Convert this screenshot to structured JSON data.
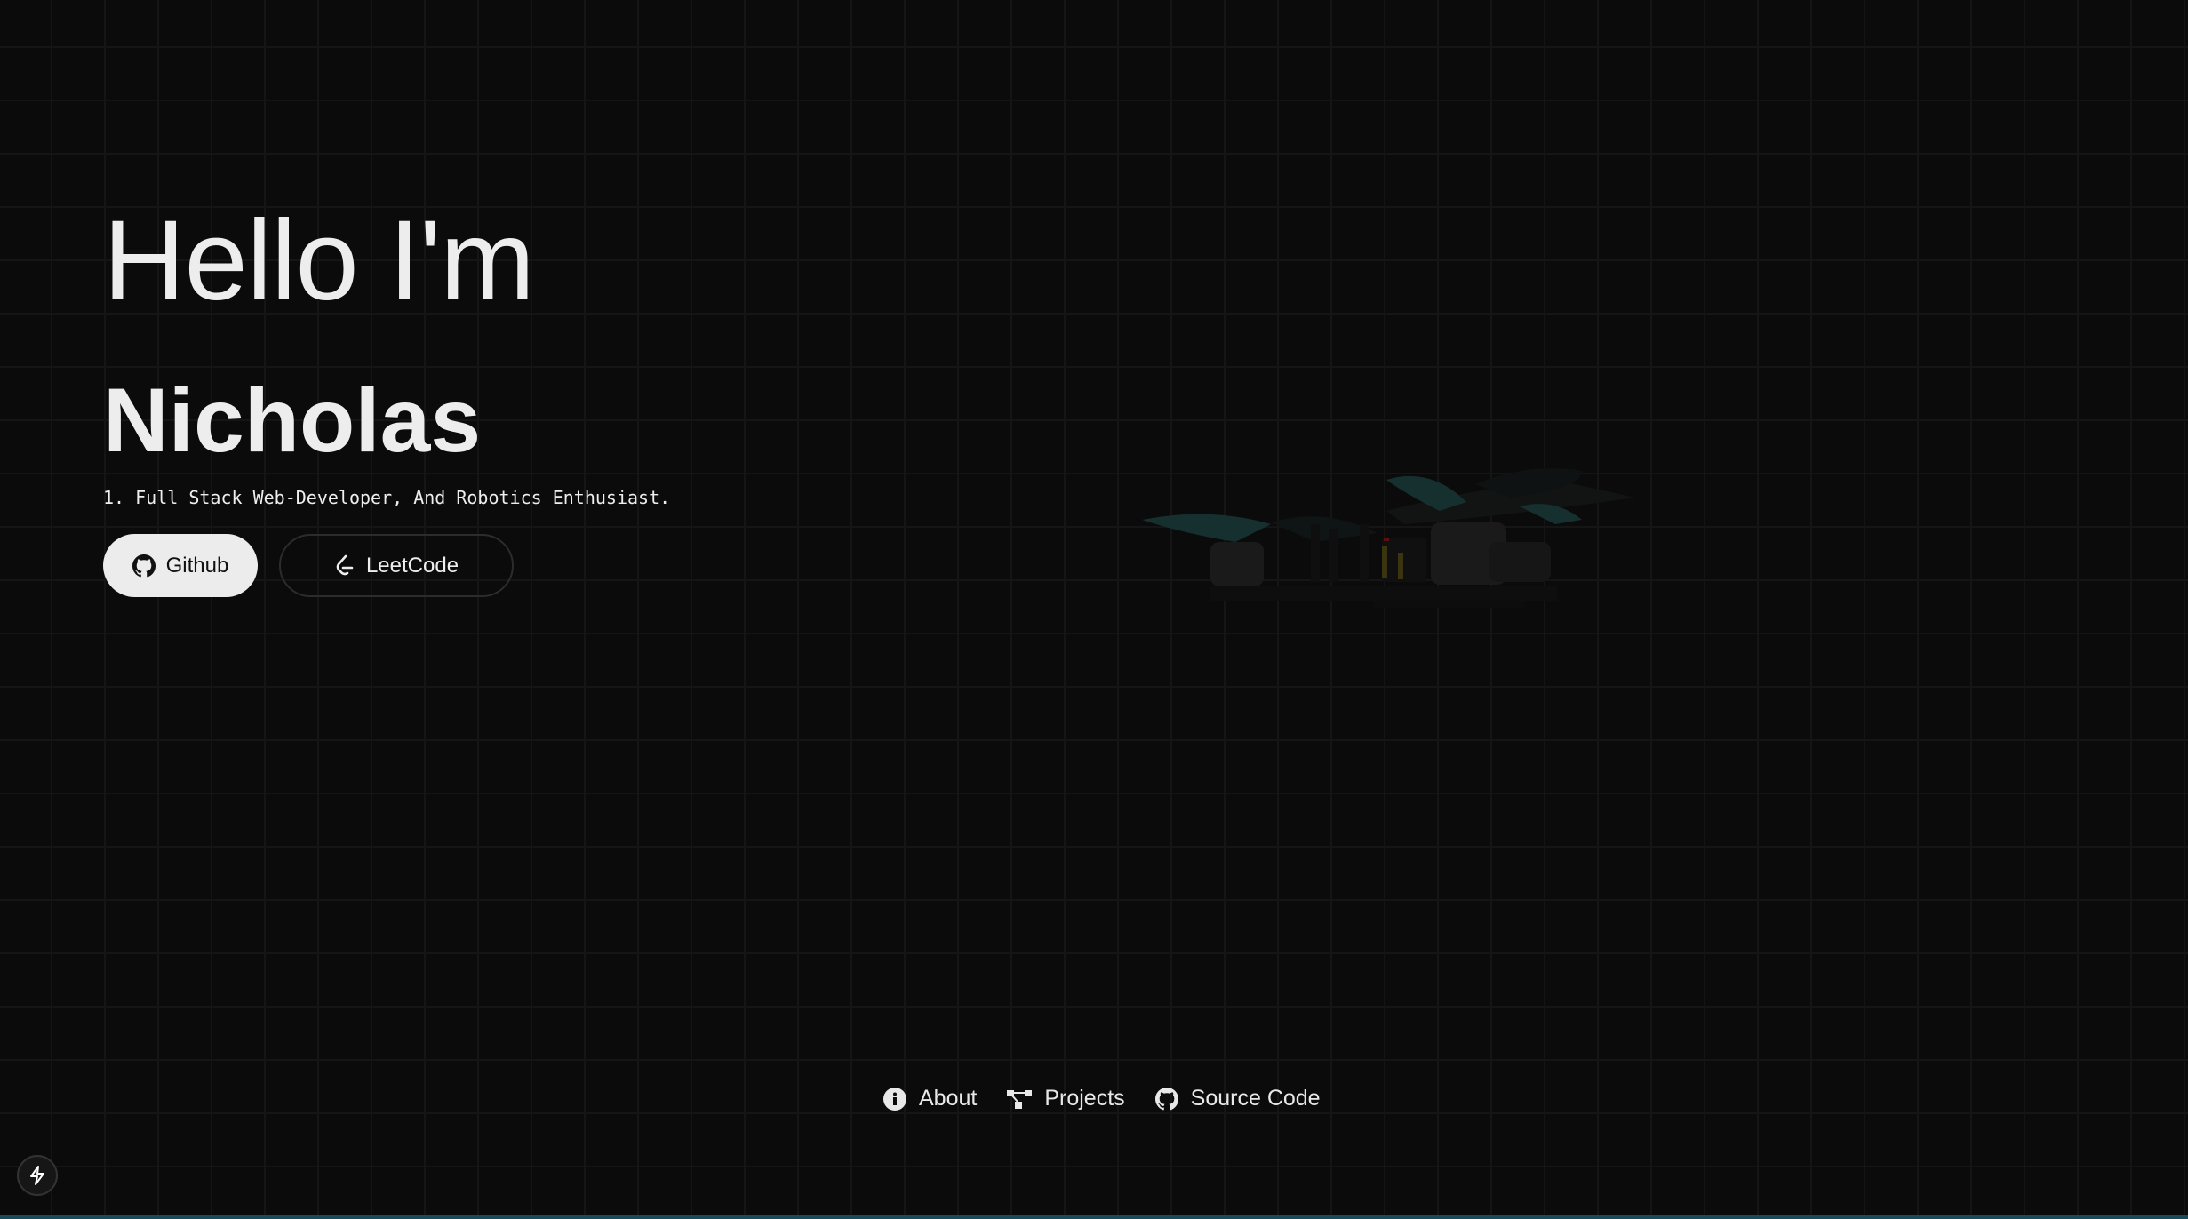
{
  "hero": {
    "greeting": "Hello I'm",
    "name": "Nicholas",
    "tagline": "1. Full Stack Web-Developer, And Robotics Enthusiast.",
    "buttons": [
      {
        "label": "Github",
        "icon": "github-icon"
      },
      {
        "label": "LeetCode",
        "icon": "leetcode-icon"
      }
    ]
  },
  "nav": {
    "items": [
      {
        "label": "About",
        "icon": "info-icon"
      },
      {
        "label": "Projects",
        "icon": "projects-icon"
      },
      {
        "label": "Source Code",
        "icon": "github-icon"
      }
    ]
  },
  "colors": {
    "background": "#0b0b0b",
    "accent_bar": "#1a4b5a",
    "text": "#ededed"
  }
}
